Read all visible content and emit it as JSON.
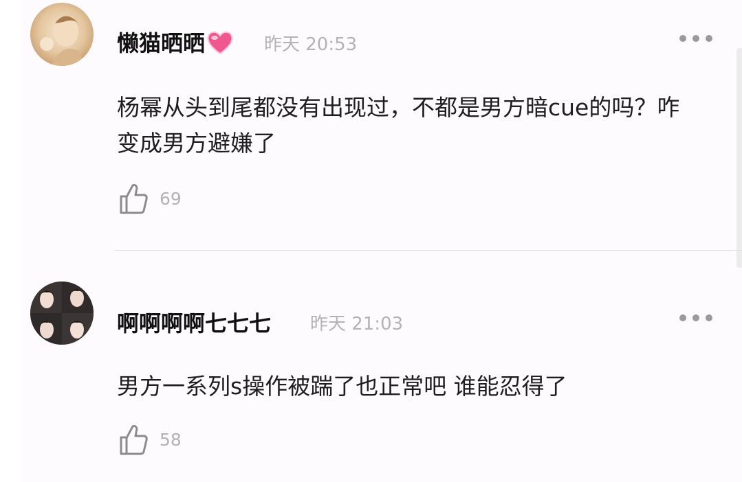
{
  "comments": [
    {
      "username": "懒猫晒晒",
      "badge_icon": "pink-heart-icon",
      "time": "昨天 20:53",
      "text": "杨幂从头到尾都没有出现过，不都是男方暗cue的吗？咋变成男方避嫌了",
      "likes": "69"
    },
    {
      "username": "啊啊啊啊七七七",
      "time": "昨天 21:03",
      "text": "男方一系列s操作被踹了也正常吧 谁能忍得了",
      "likes": "58"
    }
  ],
  "icons": {
    "like": "thumbs-up-icon",
    "more": "more-dots-icon"
  },
  "colors": {
    "background": "#fdfbfd",
    "username": "#111111",
    "meta": "#b3b3b3",
    "heart": "#f0578f"
  }
}
